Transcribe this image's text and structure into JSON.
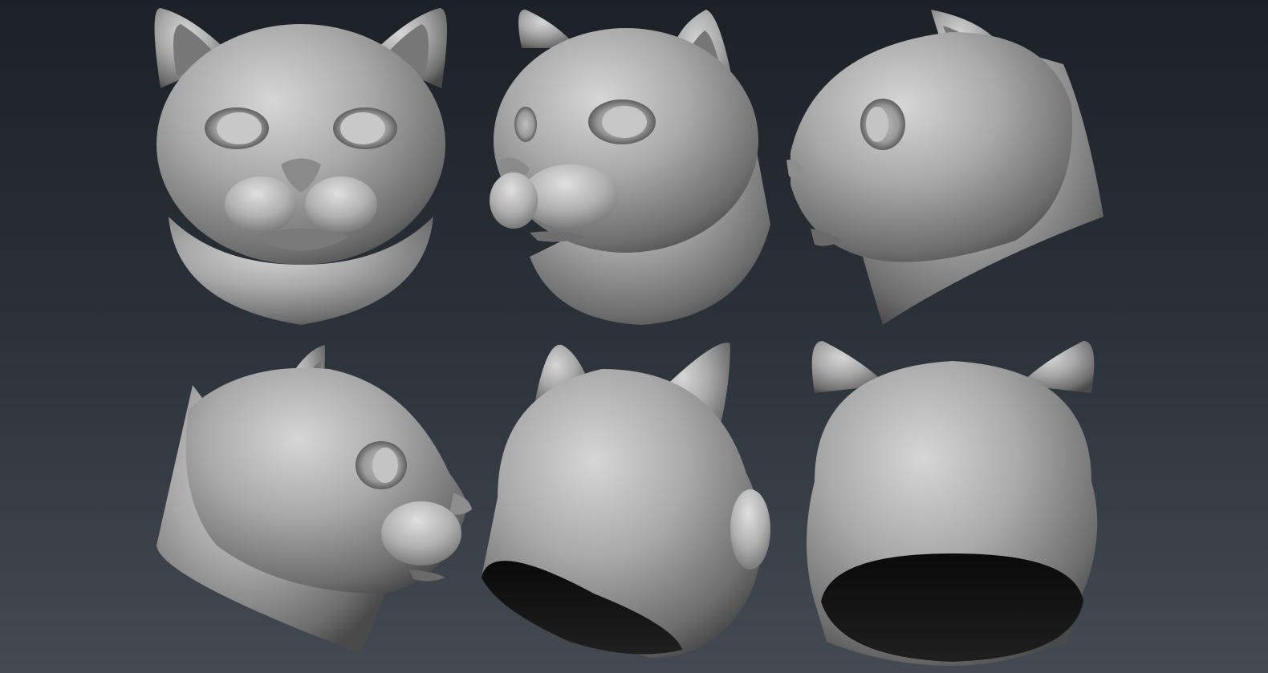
{
  "viewport": {
    "background_top": "#1c2127",
    "background_bottom": "#434a52",
    "clay_color": "#9c9c9c"
  },
  "views": [
    {
      "name": "front-view"
    },
    {
      "name": "three-quarter-view"
    },
    {
      "name": "left-profile-view"
    },
    {
      "name": "right-profile-view"
    },
    {
      "name": "back-three-quarter-view"
    },
    {
      "name": "back-view"
    }
  ]
}
